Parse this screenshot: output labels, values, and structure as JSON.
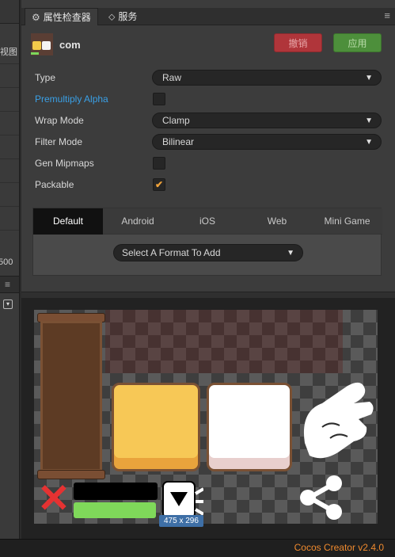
{
  "left_panel": {
    "label": "视图",
    "number": "500"
  },
  "tabs": [
    {
      "label": "属性检查器",
      "icon": "gear-icon",
      "active": true
    },
    {
      "label": "服务",
      "icon": "link-icon",
      "active": false
    }
  ],
  "asset": {
    "name": "com"
  },
  "buttons": {
    "revert": "撤销",
    "apply": "应用"
  },
  "colors": {
    "revert": "#b0353a",
    "apply": "#4d8f3b",
    "link": "#3aa0e6",
    "version": "#f08a2e",
    "check": "#f0a33a"
  },
  "props": {
    "type": {
      "label": "Type",
      "value": "Raw"
    },
    "premultiply": {
      "label": "Premultiply Alpha",
      "checked": false
    },
    "wrap": {
      "label": "Wrap Mode",
      "value": "Clamp"
    },
    "filter": {
      "label": "Filter Mode",
      "value": "Bilinear"
    },
    "mipmaps": {
      "label": "Gen Mipmaps",
      "checked": false
    },
    "packable": {
      "label": "Packable",
      "checked": true,
      "mark": "✔"
    }
  },
  "platform_tabs": [
    "Default",
    "Android",
    "iOS",
    "Web",
    "Mini Game"
  ],
  "active_platform": "Default",
  "format_select": {
    "value": "Select A Format To Add"
  },
  "preview": {
    "size": "475 x 296"
  },
  "status": {
    "version": "Cocos Creator v2.4.0"
  }
}
